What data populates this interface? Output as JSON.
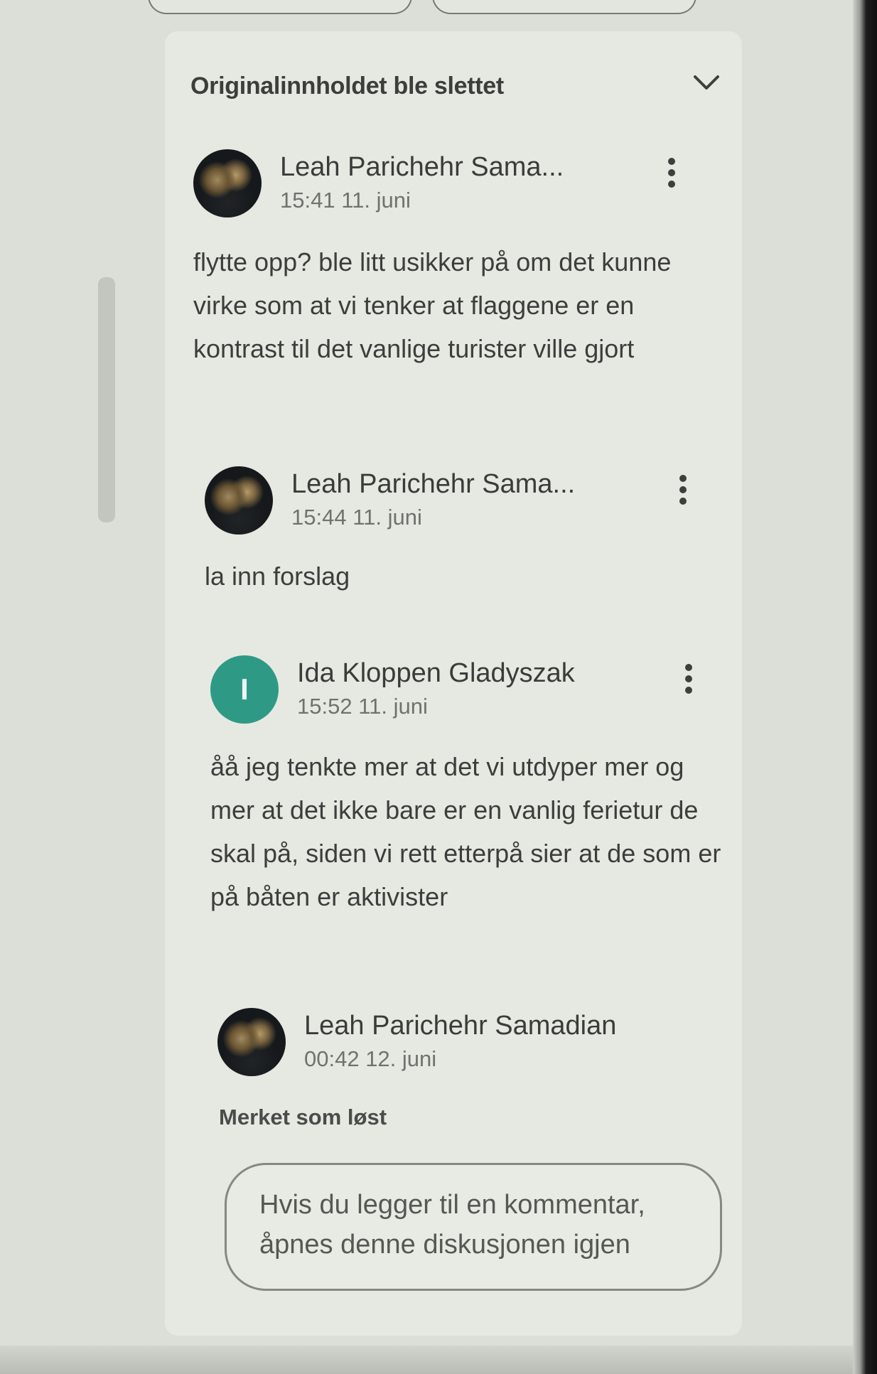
{
  "thread": {
    "title": "Originalinnholdet ble slettet"
  },
  "comments": [
    {
      "author": "Leah Parichehr Sama...",
      "timestamp": "15:41 11. juni",
      "body": "flytte opp? ble litt usikker på om det kunne virke som at vi tenker at flaggene er en kontrast til det vanlige turister ville gjort"
    },
    {
      "author": "Leah Parichehr Sama...",
      "timestamp": "15:44 11. juni",
      "body": "la inn forslag"
    },
    {
      "author": "Ida Kloppen Gladyszak",
      "avatar_initial": "I",
      "timestamp": "15:52 11. juni",
      "body": "åå jeg tenkte mer at det vi utdyper mer og mer at det ikke bare er en vanlig ferietur de skal på, siden vi rett etterpå sier at de som er på båten er aktivister"
    }
  ],
  "resolution": {
    "author": "Leah Parichehr Samadian",
    "timestamp": "00:42 12. juni",
    "status": "Merket som løst"
  },
  "reopen": {
    "text": "Hvis du legger til en kommentar, åpnes denne diskusjonen igjen"
  },
  "colors": {
    "panel_background": "#e6e9e2",
    "avatar_initial_bg": "#2e9a86",
    "text_primary": "#3c3e3b",
    "text_secondary": "#6f726d"
  },
  "icons": {
    "collapse": "chevron-down-icon",
    "more": "more-vertical-icon"
  }
}
